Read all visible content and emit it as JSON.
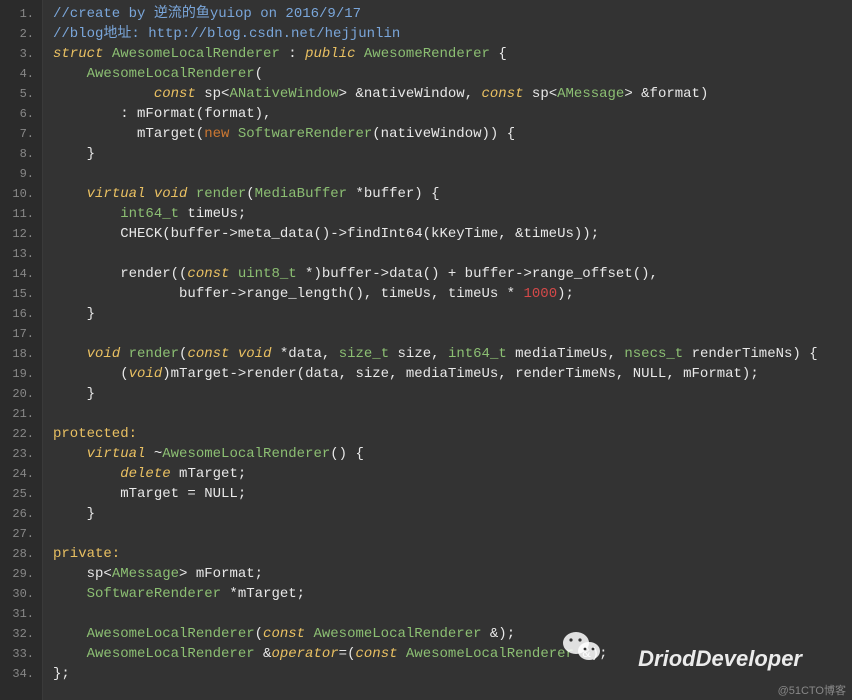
{
  "lines": [
    {
      "n": "1.",
      "tokens": [
        {
          "cls": "c-comment",
          "t": "//create by 逆流的鱼yuiop on 2016/9/17"
        }
      ]
    },
    {
      "n": "2.",
      "tokens": [
        {
          "cls": "c-comment",
          "t": "//blog地址: http://blog.csdn.net/hejjunlin"
        }
      ]
    },
    {
      "n": "3.",
      "tokens": [
        {
          "cls": "c-keyword",
          "t": "struct"
        },
        {
          "cls": "c-plain",
          "t": " "
        },
        {
          "cls": "c-type",
          "t": "AwesomeLocalRenderer"
        },
        {
          "cls": "c-plain",
          "t": " : "
        },
        {
          "cls": "c-keyword",
          "t": "public"
        },
        {
          "cls": "c-plain",
          "t": " "
        },
        {
          "cls": "c-type",
          "t": "AwesomeRenderer"
        },
        {
          "cls": "c-plain",
          "t": " {"
        }
      ]
    },
    {
      "n": "4.",
      "tokens": [
        {
          "cls": "c-plain",
          "t": "    "
        },
        {
          "cls": "c-type",
          "t": "AwesomeLocalRenderer"
        },
        {
          "cls": "c-plain",
          "t": "("
        }
      ]
    },
    {
      "n": "5.",
      "tokens": [
        {
          "cls": "c-plain",
          "t": "            "
        },
        {
          "cls": "c-keyword",
          "t": "const"
        },
        {
          "cls": "c-plain",
          "t": " sp<"
        },
        {
          "cls": "c-type",
          "t": "ANativeWindow"
        },
        {
          "cls": "c-plain",
          "t": "> &nativeWindow, "
        },
        {
          "cls": "c-keyword",
          "t": "const"
        },
        {
          "cls": "c-plain",
          "t": " sp<"
        },
        {
          "cls": "c-type",
          "t": "AMessage"
        },
        {
          "cls": "c-plain",
          "t": "> &format)"
        }
      ]
    },
    {
      "n": "6.",
      "tokens": [
        {
          "cls": "c-plain",
          "t": "        : mFormat(format),"
        }
      ]
    },
    {
      "n": "7.",
      "tokens": [
        {
          "cls": "c-plain",
          "t": "          mTarget("
        },
        {
          "cls": "c-new",
          "t": "new"
        },
        {
          "cls": "c-plain",
          "t": " "
        },
        {
          "cls": "c-type",
          "t": "SoftwareRenderer"
        },
        {
          "cls": "c-plain",
          "t": "(nativeWindow)) {"
        }
      ]
    },
    {
      "n": "8.",
      "tokens": [
        {
          "cls": "c-plain",
          "t": "    }"
        }
      ]
    },
    {
      "n": "9.",
      "tokens": [
        {
          "cls": "c-plain",
          "t": " "
        }
      ]
    },
    {
      "n": "10.",
      "tokens": [
        {
          "cls": "c-plain",
          "t": "    "
        },
        {
          "cls": "c-keyword",
          "t": "virtual"
        },
        {
          "cls": "c-plain",
          "t": " "
        },
        {
          "cls": "c-keyword",
          "t": "void"
        },
        {
          "cls": "c-plain",
          "t": " "
        },
        {
          "cls": "c-memf",
          "t": "render"
        },
        {
          "cls": "c-plain",
          "t": "("
        },
        {
          "cls": "c-type",
          "t": "MediaBuffer"
        },
        {
          "cls": "c-plain",
          "t": " *buffer) {"
        }
      ]
    },
    {
      "n": "11.",
      "tokens": [
        {
          "cls": "c-plain",
          "t": "        "
        },
        {
          "cls": "c-type",
          "t": "int64_t"
        },
        {
          "cls": "c-plain",
          "t": " timeUs;"
        }
      ]
    },
    {
      "n": "12.",
      "tokens": [
        {
          "cls": "c-plain",
          "t": "        CHECK(buffer->meta_data()->findInt64(kKeyTime, &timeUs));"
        }
      ]
    },
    {
      "n": "13.",
      "tokens": [
        {
          "cls": "c-plain",
          "t": " "
        }
      ]
    },
    {
      "n": "14.",
      "tokens": [
        {
          "cls": "c-plain",
          "t": "        render(("
        },
        {
          "cls": "c-keyword",
          "t": "const"
        },
        {
          "cls": "c-plain",
          "t": " "
        },
        {
          "cls": "c-type",
          "t": "uint8_t"
        },
        {
          "cls": "c-plain",
          "t": " *)buffer->data() + buffer->range_offset(),"
        }
      ]
    },
    {
      "n": "15.",
      "tokens": [
        {
          "cls": "c-plain",
          "t": "               buffer->range_length(), timeUs, timeUs * "
        },
        {
          "cls": "c-num",
          "t": "1000"
        },
        {
          "cls": "c-plain",
          "t": ");"
        }
      ]
    },
    {
      "n": "16.",
      "tokens": [
        {
          "cls": "c-plain",
          "t": "    }"
        }
      ]
    },
    {
      "n": "17.",
      "tokens": [
        {
          "cls": "c-plain",
          "t": " "
        }
      ]
    },
    {
      "n": "18.",
      "tokens": [
        {
          "cls": "c-plain",
          "t": "    "
        },
        {
          "cls": "c-keyword",
          "t": "void"
        },
        {
          "cls": "c-plain",
          "t": " "
        },
        {
          "cls": "c-memf",
          "t": "render"
        },
        {
          "cls": "c-plain",
          "t": "("
        },
        {
          "cls": "c-keyword",
          "t": "const"
        },
        {
          "cls": "c-plain",
          "t": " "
        },
        {
          "cls": "c-keyword",
          "t": "void"
        },
        {
          "cls": "c-plain",
          "t": " *data, "
        },
        {
          "cls": "c-type",
          "t": "size_t"
        },
        {
          "cls": "c-plain",
          "t": " size, "
        },
        {
          "cls": "c-type",
          "t": "int64_t"
        },
        {
          "cls": "c-plain",
          "t": " mediaTimeUs, "
        },
        {
          "cls": "c-type",
          "t": "nsecs_t"
        },
        {
          "cls": "c-plain",
          "t": " renderTimeNs) {"
        }
      ]
    },
    {
      "n": "19.",
      "tokens": [
        {
          "cls": "c-plain",
          "t": "        ("
        },
        {
          "cls": "c-keyword",
          "t": "void"
        },
        {
          "cls": "c-plain",
          "t": ")"
        },
        {
          "cls": "c-plain",
          "t": "mTarget->render(data, size, mediaTimeUs, renderTimeNs, NULL, mFormat);"
        }
      ]
    },
    {
      "n": "20.",
      "tokens": [
        {
          "cls": "c-plain",
          "t": "    }"
        }
      ]
    },
    {
      "n": "21.",
      "tokens": [
        {
          "cls": "c-plain",
          "t": " "
        }
      ]
    },
    {
      "n": "22.",
      "tokens": [
        {
          "cls": "c-label",
          "t": "protected:"
        }
      ]
    },
    {
      "n": "23.",
      "tokens": [
        {
          "cls": "c-plain",
          "t": "    "
        },
        {
          "cls": "c-keyword",
          "t": "virtual"
        },
        {
          "cls": "c-plain",
          "t": " ~"
        },
        {
          "cls": "c-type",
          "t": "AwesomeLocalRenderer"
        },
        {
          "cls": "c-plain",
          "t": "() {"
        }
      ]
    },
    {
      "n": "24.",
      "tokens": [
        {
          "cls": "c-plain",
          "t": "        "
        },
        {
          "cls": "c-keyword",
          "t": "delete"
        },
        {
          "cls": "c-plain",
          "t": " mTarget;"
        }
      ]
    },
    {
      "n": "25.",
      "tokens": [
        {
          "cls": "c-plain",
          "t": "        mTarget = NULL;"
        }
      ]
    },
    {
      "n": "26.",
      "tokens": [
        {
          "cls": "c-plain",
          "t": "    }"
        }
      ]
    },
    {
      "n": "27.",
      "tokens": [
        {
          "cls": "c-plain",
          "t": " "
        }
      ]
    },
    {
      "n": "28.",
      "tokens": [
        {
          "cls": "c-label",
          "t": "private:"
        }
      ]
    },
    {
      "n": "29.",
      "tokens": [
        {
          "cls": "c-plain",
          "t": "    sp<"
        },
        {
          "cls": "c-type",
          "t": "AMessage"
        },
        {
          "cls": "c-plain",
          "t": "> mFormat;"
        }
      ]
    },
    {
      "n": "30.",
      "tokens": [
        {
          "cls": "c-plain",
          "t": "    "
        },
        {
          "cls": "c-type",
          "t": "SoftwareRenderer"
        },
        {
          "cls": "c-plain",
          "t": " *mTarget;"
        }
      ]
    },
    {
      "n": "31.",
      "tokens": [
        {
          "cls": "c-plain",
          "t": " "
        }
      ]
    },
    {
      "n": "32.",
      "tokens": [
        {
          "cls": "c-plain",
          "t": "    "
        },
        {
          "cls": "c-type",
          "t": "AwesomeLocalRenderer"
        },
        {
          "cls": "c-plain",
          "t": "("
        },
        {
          "cls": "c-keyword",
          "t": "const"
        },
        {
          "cls": "c-plain",
          "t": " "
        },
        {
          "cls": "c-type",
          "t": "AwesomeLocalRenderer"
        },
        {
          "cls": "c-plain",
          "t": " &);"
        }
      ]
    },
    {
      "n": "33.",
      "tokens": [
        {
          "cls": "c-plain",
          "t": "    "
        },
        {
          "cls": "c-type",
          "t": "AwesomeLocalRenderer"
        },
        {
          "cls": "c-plain",
          "t": " &"
        },
        {
          "cls": "c-keyword",
          "t": "operator"
        },
        {
          "cls": "c-plain",
          "t": "=("
        },
        {
          "cls": "c-keyword",
          "t": "const"
        },
        {
          "cls": "c-plain",
          "t": " "
        },
        {
          "cls": "c-type",
          "t": "AwesomeLocalRenderer"
        },
        {
          "cls": "c-plain",
          "t": " &);"
        }
      ]
    },
    {
      "n": "34.",
      "tokens": [
        {
          "cls": "c-plain",
          "t": "};"
        }
      ]
    }
  ],
  "watermark": {
    "brand": "DriodDeveloper",
    "attribution": "@51CTO博客"
  }
}
